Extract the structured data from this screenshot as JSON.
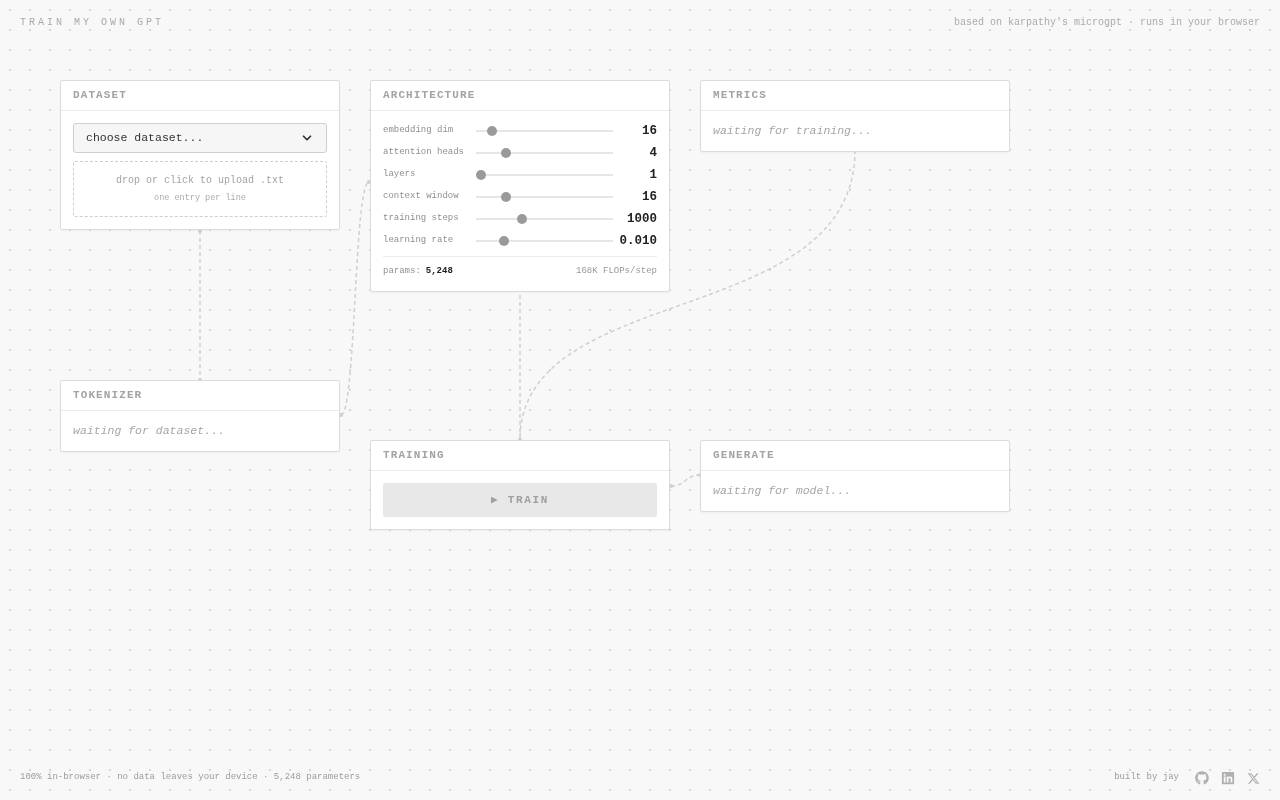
{
  "header": {
    "title": "TRAIN MY OWN GPT",
    "tagline": "based on karpathy's microgpt · runs in your browser"
  },
  "dataset": {
    "title": "DATASET",
    "select": {
      "value": "choose dataset..."
    },
    "upload": {
      "label": "drop or click to upload .txt",
      "hint": "one entry per line"
    }
  },
  "architecture": {
    "title": "ARCHITECTURE",
    "sliders": [
      {
        "label": "embedding dim",
        "level": 0.09,
        "reading": "16"
      },
      {
        "label": "attention heads",
        "level": 0.2,
        "reading": "4"
      },
      {
        "label": "layers",
        "level": 0,
        "reading": "1"
      },
      {
        "label": "context window",
        "level": 0.2,
        "reading": "16"
      },
      {
        "label": "training steps",
        "level": 0.32,
        "reading": "1000"
      },
      {
        "label": "learning rate",
        "level": 0.18,
        "reading": "0.010"
      }
    ],
    "params_label": "params:",
    "params_value": "5,248",
    "flops": "168K FLOPs/step"
  },
  "metrics": {
    "title": "METRICS",
    "status": "waiting for training..."
  },
  "tokenizer": {
    "title": "TOKENIZER",
    "status": "waiting for dataset..."
  },
  "training": {
    "title": "TRAINING",
    "train_button": {
      "label": "▶ TRAIN",
      "disabled": true
    }
  },
  "generate": {
    "title": "GENERATE",
    "status": "waiting for model..."
  },
  "footer": {
    "info": "100% in-browser · no data leaves your device · 5,248 parameters",
    "credit": "built by jay"
  }
}
